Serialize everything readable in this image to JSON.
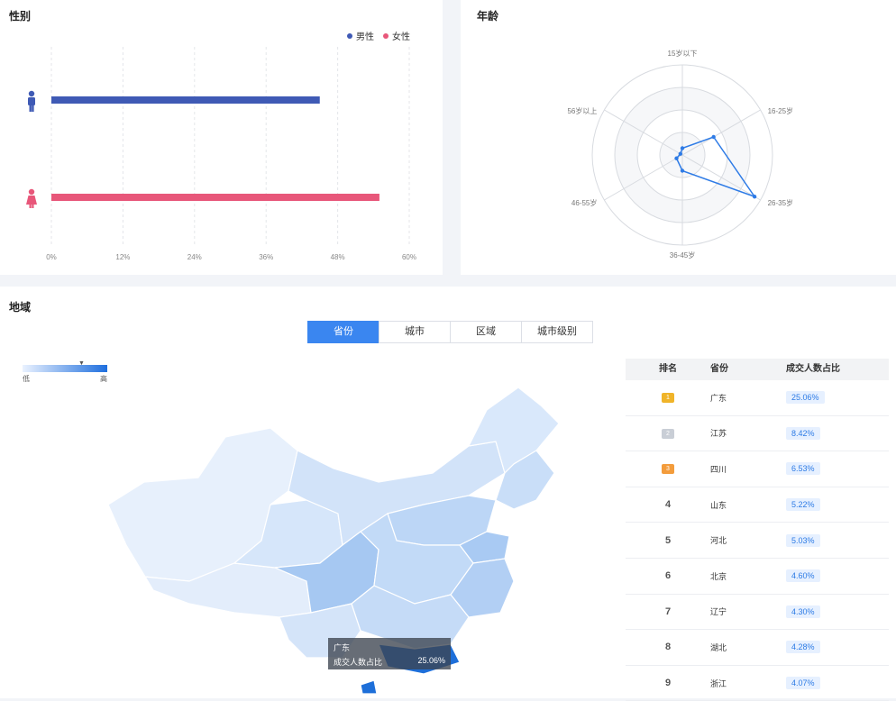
{
  "gender": {
    "title": "性别",
    "legend": [
      {
        "label": "男性",
        "color": "#3f5ab5"
      },
      {
        "label": "女性",
        "color": "#e8577a"
      }
    ],
    "icons": {
      "male": "male-person-icon",
      "female": "female-person-icon"
    },
    "chart_data": {
      "type": "bar",
      "orientation": "horizontal",
      "categories": [
        "男性",
        "女性"
      ],
      "values": [
        45,
        55
      ],
      "xlim": [
        0,
        60
      ],
      "x_ticks": [
        "0%",
        "12%",
        "24%",
        "36%",
        "48%",
        "60%"
      ],
      "grid": true,
      "legend_position": "top-right"
    }
  },
  "age": {
    "title": "年龄",
    "chart_data": {
      "type": "radar",
      "categories": [
        "15岁以下",
        "16-25岁",
        "26-35岁",
        "36-45岁",
        "46-55岁",
        "56岁以上"
      ],
      "values": [
        3,
        16,
        37,
        7,
        3,
        1
      ],
      "rlim": [
        0,
        40
      ],
      "color": "#2e7be6"
    }
  },
  "region": {
    "title": "地域",
    "tabs": [
      "省份",
      "城市",
      "区域",
      "城市级别"
    ],
    "active_tab": "省份",
    "scale": {
      "low": "低",
      "high": "高"
    },
    "table": {
      "headers": [
        "排名",
        "省份",
        "成交人数占比"
      ],
      "rows": [
        {
          "rank": "1",
          "name": "广东",
          "pct": "25.06%"
        },
        {
          "rank": "2",
          "name": "江苏",
          "pct": "8.42%"
        },
        {
          "rank": "3",
          "name": "四川",
          "pct": "6.53%"
        },
        {
          "rank": "4",
          "name": "山东",
          "pct": "5.22%"
        },
        {
          "rank": "5",
          "name": "河北",
          "pct": "5.03%"
        },
        {
          "rank": "6",
          "name": "北京",
          "pct": "4.60%"
        },
        {
          "rank": "7",
          "name": "辽宁",
          "pct": "4.30%"
        },
        {
          "rank": "8",
          "name": "湖北",
          "pct": "4.28%"
        },
        {
          "rank": "9",
          "name": "浙江",
          "pct": "4.07%"
        }
      ]
    },
    "tooltip": {
      "title": "广东",
      "label": "成交人数占比",
      "value": "25.06%"
    },
    "map_icon": "china-map"
  },
  "colors": {
    "accent": "#3a86f0",
    "male": "#3f5ab5",
    "female": "#e8577a",
    "gold": "#f0b429",
    "silver": "#c9ced6",
    "bronze": "#f39c3c"
  }
}
